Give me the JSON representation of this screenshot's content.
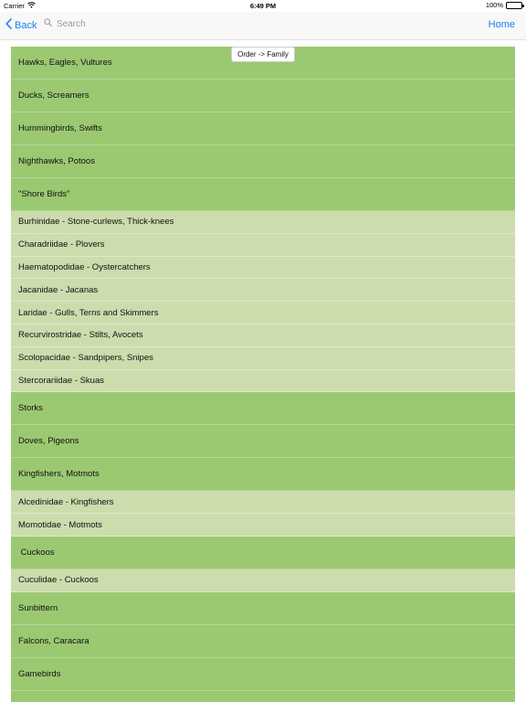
{
  "status_bar": {
    "carrier": "Carrier",
    "time": "6:49 PM",
    "battery": "100%"
  },
  "nav": {
    "back_label": "Back",
    "search_placeholder": "Search",
    "home_label": "Home"
  },
  "toggle": {
    "label": "Order -> Family"
  },
  "rows": [
    {
      "type": "order",
      "label": "Hawks, Eagles, Vultures"
    },
    {
      "type": "order",
      "label": "Ducks, Screamers"
    },
    {
      "type": "order",
      "label": "Hummingbirds, Swifts"
    },
    {
      "type": "order",
      "label": "Nighthawks, Potoos"
    },
    {
      "type": "order",
      "label": "\"Shore Birds\""
    },
    {
      "type": "family",
      "label": "Burhinidae - Stone-curlews, Thick-knees"
    },
    {
      "type": "family",
      "label": "Charadriidae - Plovers"
    },
    {
      "type": "family",
      "label": "Haematopodidae - Oystercatchers"
    },
    {
      "type": "family",
      "label": "Jacanidae - Jacanas"
    },
    {
      "type": "family",
      "label": "Laridae - Gulls, Terns and Skimmers"
    },
    {
      "type": "family",
      "label": "Recurvirostridae - Stilts, Avocets"
    },
    {
      "type": "family",
      "label": "Scolopacidae - Sandpipers, Snipes"
    },
    {
      "type": "family",
      "label": "Stercorariidae - Skuas"
    },
    {
      "type": "order",
      "label": "Storks"
    },
    {
      "type": "order",
      "label": "Doves, Pigeons"
    },
    {
      "type": "order",
      "label": "Kingfishers, Motmots"
    },
    {
      "type": "family",
      "label": "Alcedinidae - Kingfishers"
    },
    {
      "type": "family",
      "label": "Momotidae - Motmots"
    },
    {
      "type": "order",
      "label": " Cuckoos"
    },
    {
      "type": "family",
      "label": "Cuculidae - Cuckoos"
    },
    {
      "type": "order",
      "label": "Sunbittern"
    },
    {
      "type": "order",
      "label": "Falcons, Caracara"
    },
    {
      "type": "order",
      "label": "Gamebirds"
    },
    {
      "type": "order",
      "label": ""
    }
  ],
  "colors": {
    "order_row": "#9bc971",
    "family_row": "#ccdcad",
    "accent": "#1a7cf5"
  },
  "icons": {
    "wifi": "wifi-icon",
    "back": "chevron-left-icon",
    "search": "search-icon",
    "battery": "battery-icon"
  }
}
